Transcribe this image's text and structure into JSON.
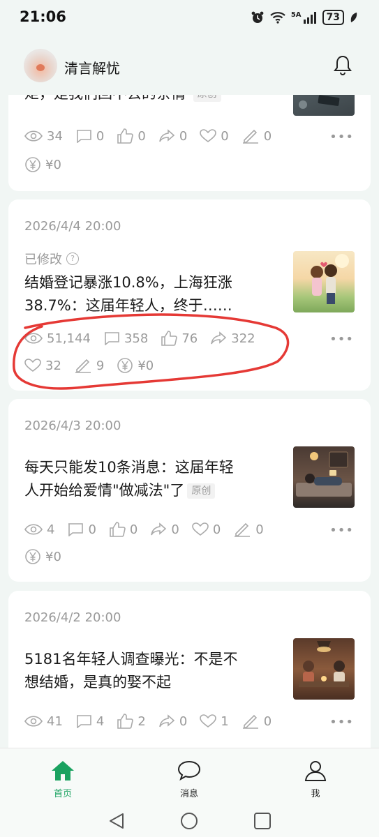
{
  "status_bar": {
    "time": "21:06",
    "network": "5A",
    "battery": "73"
  },
  "header": {
    "account_name": "清言解忧"
  },
  "posts": [
    {
      "title_visible": "矩，是我们回不去的亲情",
      "badge": "原创",
      "stats": {
        "views": "34",
        "comments": "0",
        "likes": "0",
        "shares": "0",
        "favorites": "0",
        "edits": "0",
        "earnings": "¥0"
      }
    },
    {
      "date": "2026/4/4 20:00",
      "modified_label": "已修改",
      "title": "结婚登记暴涨10.8%，上海狂涨38.7%：这届年轻人，终于……",
      "title_line1": "结婚登记暴涨10.8%，上海狂涨",
      "title_line2": "38.7%：这届年轻人，终于……",
      "stats": {
        "views": "51,144",
        "comments": "358",
        "likes": "76",
        "shares": "322",
        "favorites": "32",
        "edits": "9",
        "earnings": "¥0"
      }
    },
    {
      "date": "2026/4/3 20:00",
      "title_line1": "每天只能发10条消息：这届年轻",
      "title_line2": "人开始给爱情\"做减法\"了",
      "badge": "原创",
      "stats": {
        "views": "4",
        "comments": "0",
        "likes": "0",
        "shares": "0",
        "favorites": "0",
        "edits": "0",
        "earnings": "¥0"
      }
    },
    {
      "date": "2026/4/2 20:00",
      "title_line1": "5181名年轻人调查曝光：不是不",
      "title_line2": "想结婚，是真的娶不起",
      "stats": {
        "views": "41",
        "comments": "4",
        "likes": "2",
        "shares": "0",
        "favorites": "1",
        "edits": "0"
      }
    }
  ],
  "bottom_nav": [
    {
      "label": "首页",
      "icon": "home-icon",
      "active": true
    },
    {
      "label": "消息",
      "icon": "chat-icon",
      "active": false
    },
    {
      "label": "我",
      "icon": "user-icon",
      "active": false
    }
  ],
  "colors": {
    "accent": "#1aa260",
    "annotation": "#e53935",
    "background": "#f1f6f4"
  }
}
